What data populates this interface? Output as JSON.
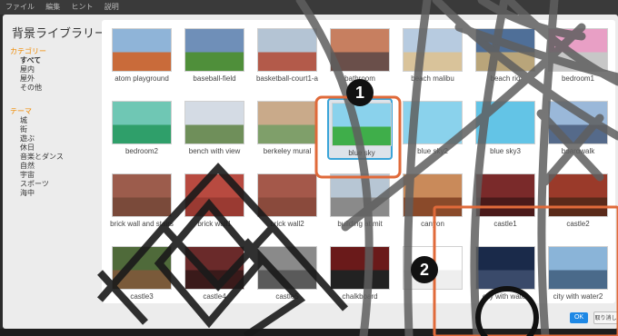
{
  "menubar": {
    "items": [
      "ファイル",
      "編集",
      "ヒント",
      "説明"
    ]
  },
  "dialog": {
    "title": "背景ライブラリー"
  },
  "sidebar": {
    "sections": [
      {
        "heading": "カテゴリー",
        "items": [
          "すべて",
          "屋内",
          "屋外",
          "その他"
        ],
        "selected": 0
      },
      {
        "heading": "テーマ",
        "items": [
          "城",
          "街",
          "遊ぶ",
          "休日",
          "音楽とダンス",
          "自然",
          "宇宙",
          "スポーツ",
          "海中"
        ],
        "selected": -1
      }
    ]
  },
  "tiles": [
    {
      "label": "atom playground",
      "colors": [
        "#8fb4d8",
        "#c96b3a"
      ]
    },
    {
      "label": "baseball-field",
      "colors": [
        "#6f8fb8",
        "#4f8f3a"
      ]
    },
    {
      "label": "basketball-court1-a",
      "colors": [
        "#b4c4d4",
        "#b35a4a"
      ]
    },
    {
      "label": "bathroom",
      "colors": [
        "#c77f60",
        "#6a4f4a"
      ]
    },
    {
      "label": "beach malibu",
      "colors": [
        "#b7cbe0",
        "#d9c39a"
      ]
    },
    {
      "label": "beach rio",
      "colors": [
        "#4f6f98",
        "#b9a57a"
      ]
    },
    {
      "label": "bedroom1",
      "colors": [
        "#e89fc5",
        "#c7c7c7"
      ]
    },
    {
      "label": "bedroom2",
      "colors": [
        "#6fc7b4",
        "#2f9f6a"
      ]
    },
    {
      "label": "bench with view",
      "colors": [
        "#d4dbe4",
        "#6f8f5a"
      ]
    },
    {
      "label": "berkeley mural",
      "colors": [
        "#c9aa8a",
        "#7f9f6a"
      ]
    },
    {
      "label": "blue sky",
      "colors": [
        "#8ad2ec",
        "#3fae4a"
      ]
    },
    {
      "label": "blue sky2",
      "colors": [
        "#8ad2ec",
        "#8ad2ec"
      ]
    },
    {
      "label": "blue sky3",
      "colors": [
        "#63c4e6",
        "#63c4e6"
      ]
    },
    {
      "label": "boardwalk",
      "colors": [
        "#9ab8d9",
        "#556a8a"
      ]
    },
    {
      "label": "brick wall and stairs",
      "colors": [
        "#9c5c4c",
        "#7a4a3a"
      ]
    },
    {
      "label": "brick wall1",
      "colors": [
        "#b84a40",
        "#9a3a32"
      ]
    },
    {
      "label": "brick wall2",
      "colors": [
        "#a4584a",
        "#8a4a3c"
      ]
    },
    {
      "label": "building at mit",
      "colors": [
        "#b7c6d4",
        "#8a8a8a"
      ]
    },
    {
      "label": "canyon",
      "colors": [
        "#c98a5a",
        "#8a4a2a"
      ]
    },
    {
      "label": "castle1",
      "colors": [
        "#7a2a2a",
        "#4a1a1a"
      ]
    },
    {
      "label": "castle2",
      "colors": [
        "#9a3a2a",
        "#5a2a1a"
      ]
    },
    {
      "label": "castle3",
      "colors": [
        "#4f6a3a",
        "#7a5a3a"
      ]
    },
    {
      "label": "castle4",
      "colors": [
        "#6a2a2a",
        "#3a1a1a"
      ]
    },
    {
      "label": "castle5",
      "colors": [
        "#8a8a8a",
        "#5a5a5a"
      ]
    },
    {
      "label": "chalkboard",
      "colors": [
        "#6a1a1a",
        "#222222"
      ]
    },
    {
      "label": "",
      "colors": [
        "#ffffff",
        "#eeeeee"
      ]
    },
    {
      "label": "city with water",
      "colors": [
        "#1a2a4a",
        "#3a4a6a"
      ]
    },
    {
      "label": "city with water2",
      "colors": [
        "#8ab4d8",
        "#4a6a8a"
      ]
    }
  ],
  "selected_tile": 10,
  "buttons": {
    "ok": "OK",
    "cancel": "取り消し"
  },
  "callouts": [
    "1",
    "2"
  ],
  "annotation_color": "#e06a3a"
}
